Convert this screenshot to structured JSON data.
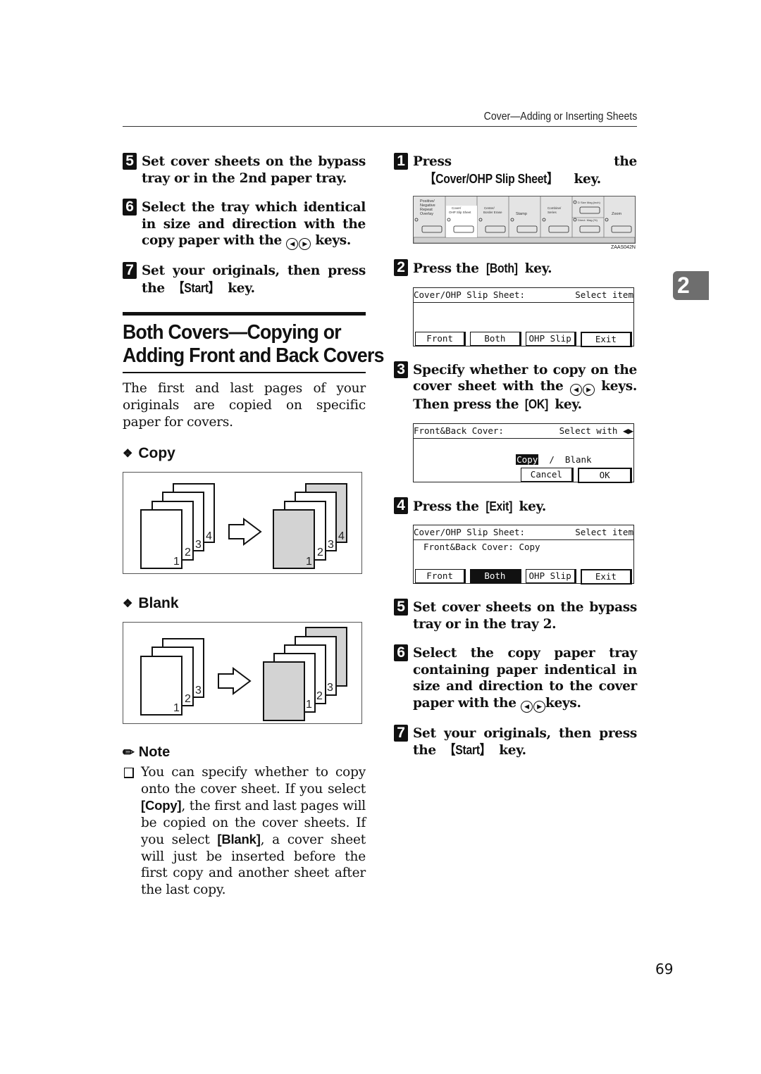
{
  "header": {
    "running_title": "Cover—Adding or Inserting Sheets"
  },
  "chapter_tab": "2",
  "page_number": "69",
  "left_column": {
    "steps": [
      {
        "num": "5",
        "text": "Set cover sheets on the bypass tray or in the 2nd paper tray."
      },
      {
        "num": "6",
        "text_before": "Select the tray which identical in size and direction with the copy paper with the",
        "text_after": "keys."
      },
      {
        "num": "7",
        "text": "Set your originals, then press the",
        "key": "【Start】",
        "text_after": "key."
      }
    ],
    "section_title_line1": "Both Covers—Copying or",
    "section_title_line2": "Adding Front and Back Covers",
    "intro": "The first and last pages of your originals are copied on specific paper for covers.",
    "copy_heading": "Copy",
    "copy_figure": {
      "before_pages": [
        "1",
        "2",
        "3",
        "4"
      ],
      "after_pages": [
        "1",
        "2",
        "3",
        "4"
      ],
      "shaded": [
        "1",
        "4"
      ]
    },
    "blank_heading": "Blank",
    "blank_figure": {
      "before_pages": [
        "1",
        "2",
        "3"
      ],
      "after_pages": [
        "1",
        "2",
        "3"
      ],
      "shaded": [
        "front-cover",
        "back-cover"
      ]
    },
    "note_heading": "Note",
    "note": {
      "part1": "You can specify whether to copy onto the cover sheet. If you select",
      "copy_key": "[Copy]",
      "part2": ", the first and last pages will be copied on the cover sheets. If you select",
      "blank_key": "[Blank]",
      "part3": ", a cover sheet will just be inserted before the first copy and another sheet after the last copy."
    }
  },
  "right_column": {
    "step1": {
      "num": "1",
      "text": "Press the",
      "key": "【Cover/OHP Slip Sheet】",
      "text_after": "key."
    },
    "control_panel": {
      "keys": [
        "Positive/ Negative Repeat Overlay",
        "Cover/ OHP Slip Sheet",
        "Center/ Border Erase",
        "Stamp",
        "Combine/ Series",
        "D Size Mag.(inch) / Direct. Mag.(%)",
        "Zoom"
      ],
      "code": "ZAAS042N"
    },
    "step2": {
      "num": "2",
      "text": "Press the",
      "key": "[Both]",
      "text_after": "key."
    },
    "lcd1": {
      "title": "Cover/OHP Slip Sheet:",
      "status": "Select item",
      "line2": "",
      "buttons": [
        {
          "label": "Front",
          "selected": false
        },
        {
          "label": "Both",
          "selected": false
        },
        {
          "label": "OHP Slip",
          "selected": false
        },
        {
          "label": "Exit",
          "selected": false
        }
      ]
    },
    "step3": {
      "num": "3",
      "text_before": "Specify whether to copy on the cover sheet with the",
      "text_mid": "keys. Then press the",
      "key": "[OK]",
      "text_after": "key."
    },
    "lcd2": {
      "title": "Front&Back Cover:",
      "status": "Select with",
      "option_selected": "Copy",
      "separator": "/",
      "option_other": "Blank",
      "buttons": [
        {
          "label": "Cancel"
        },
        {
          "label": "OK"
        }
      ]
    },
    "step4": {
      "num": "4",
      "text": "Press the",
      "key": "[Exit]",
      "text_after": "key."
    },
    "lcd3": {
      "title": "Cover/OHP Slip Sheet:",
      "status": "Select item",
      "line2": "Front&Back Cover: Copy",
      "buttons": [
        {
          "label": "Front",
          "selected": false
        },
        {
          "label": "Both",
          "selected": true
        },
        {
          "label": "OHP Slip",
          "selected": false
        },
        {
          "label": "Exit",
          "selected": false
        }
      ]
    },
    "step5": {
      "num": "5",
      "text": "Set cover sheets on the bypass tray or in the tray 2."
    },
    "step6": {
      "num": "6",
      "text_before": "Select the copy paper tray containing paper indentical in size and direction to the cover paper with the",
      "text_after": "keys."
    },
    "step7": {
      "num": "7",
      "text": "Set your originals, then press the",
      "key": "【Start】",
      "text_after": "key."
    }
  }
}
